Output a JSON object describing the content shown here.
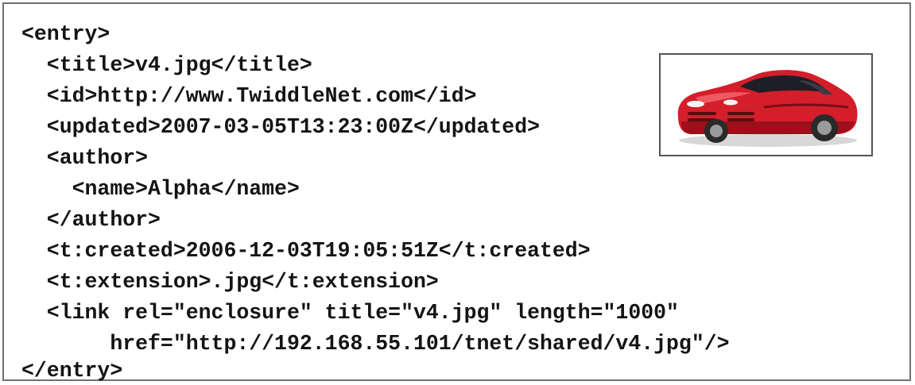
{
  "document": {
    "lines": [
      "<entry>",
      "  <title>v4.jpg</title>",
      "  <id>http://www.TwiddleNet.com</id>",
      "  <updated>2007-03-05T13:23:00Z</updated>",
      "  <author>",
      "    <name>Alpha</name>",
      "  </author>",
      "  <t:created>2006-12-03T19:05:51Z</t:created>",
      "  <t:extension>.jpg</t:extension>",
      "  <link rel=\"enclosure\" title=\"v4.jpg\" length=\"1000\"",
      "       href=\"http://192.168.55.101/tnet/shared/v4.jpg\"/>",
      "</entry>"
    ]
  },
  "thumbnail": {
    "icon": "red-sports-car-image",
    "colors": {
      "body": "#d41e2a",
      "shadow": "#7a0c14",
      "tire": "#2a2a2a",
      "glass": "#1e1e26"
    }
  }
}
